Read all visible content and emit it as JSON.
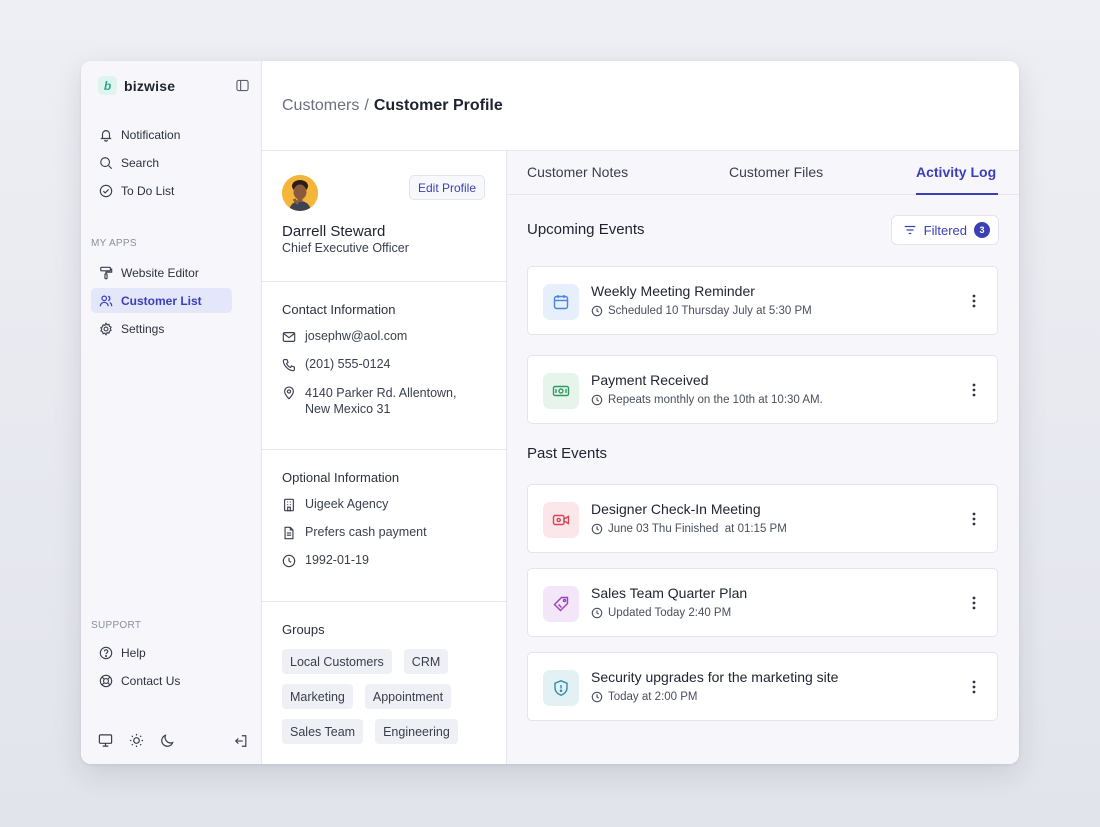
{
  "brand": {
    "name": "bizwise",
    "logo_letter": "b"
  },
  "sidebar": {
    "top_items": [
      {
        "label": "Notification",
        "icon": "bell-icon"
      },
      {
        "label": "Search",
        "icon": "search-icon"
      },
      {
        "label": "To Do List",
        "icon": "check-circle-icon"
      }
    ],
    "apps_label": "MY APPS",
    "apps_items": [
      {
        "label": "Website Editor",
        "icon": "paint-roller-icon"
      },
      {
        "label": "Customer List",
        "icon": "users-icon",
        "active": true
      },
      {
        "label": "Settings",
        "icon": "gear-icon"
      }
    ],
    "support_label": "SUPPORT",
    "support_items": [
      {
        "label": "Help",
        "icon": "help-circle-icon"
      },
      {
        "label": "Contact Us",
        "icon": "lifebuoy-icon"
      }
    ]
  },
  "header": {
    "breadcrumb_parent": "Customers",
    "breadcrumb_sep": "/",
    "breadcrumb_current": "Customer Profile"
  },
  "profile": {
    "name": "Darrell Steward",
    "title": "Chief Executive Officer",
    "edit_label": "Edit Profile",
    "contact_title": "Contact Information",
    "email": "josephw@aol.com",
    "phone": "(201) 555-0124",
    "address_line1": "4140 Parker Rd. Allentown,",
    "address_line2": "New Mexico 31",
    "optional_title": "Optional Information",
    "company": "Uigeek Agency",
    "payment_note": "Prefers cash payment",
    "date": "1992-01-19",
    "groups_title": "Groups",
    "groups": [
      "Local Customers",
      "CRM",
      "Marketing",
      "Appointment",
      "Sales Team",
      "Engineering"
    ]
  },
  "tabs": {
    "notes": "Customer Notes",
    "files": "Customer Files",
    "activity": "Activity Log"
  },
  "activity": {
    "upcoming_heading": "Upcoming Events",
    "filter_label": "Filtered",
    "filter_count": "3",
    "past_heading": "Past Events",
    "upcoming": [
      {
        "title": "Weekly Meeting Reminder",
        "meta": "Scheduled 10 Thursday July at 5:30 PM",
        "icon": "calendar-icon",
        "color": "#4a86d8",
        "bg": "#e6effb"
      },
      {
        "title": "Payment Received",
        "meta": "Repeats monthly on the 10th at 10:30 AM.",
        "icon": "money-icon",
        "color": "#2f9a5f",
        "bg": "#e6f4ec"
      }
    ],
    "past": [
      {
        "title": "Designer Check-In Meeting",
        "meta": "June 03 Thu Finished  at 01:15 PM",
        "icon": "video-icon",
        "color": "#d6455a",
        "bg": "#fbe7ea"
      },
      {
        "title": "Sales Team Quarter Plan",
        "meta": "Updated Today 2:40 PM",
        "icon": "tag-icon",
        "color": "#9b3fc0",
        "bg": "#f3e6f8"
      },
      {
        "title": "Security upgrades for the marketing site",
        "meta": "Today at 2:00 PM",
        "icon": "shield-icon",
        "color": "#2f8fa7",
        "bg": "#e4f1f4"
      }
    ]
  }
}
